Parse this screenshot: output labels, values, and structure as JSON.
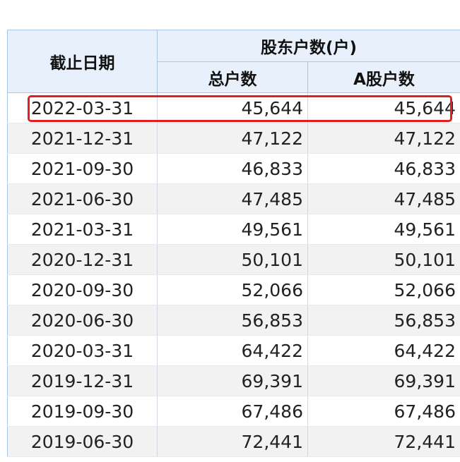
{
  "table": {
    "headers": {
      "date": "截止日期",
      "group": "股东户数(户)",
      "total": "总户数",
      "a_share": "A股户数"
    },
    "rows": [
      {
        "date": "2022-03-31",
        "total": "45,644",
        "a_share": "45,644"
      },
      {
        "date": "2021-12-31",
        "total": "47,122",
        "a_share": "47,122"
      },
      {
        "date": "2021-09-30",
        "total": "46,833",
        "a_share": "46,833"
      },
      {
        "date": "2021-06-30",
        "total": "47,485",
        "a_share": "47,485"
      },
      {
        "date": "2021-03-31",
        "total": "49,561",
        "a_share": "49,561"
      },
      {
        "date": "2020-12-31",
        "total": "50,101",
        "a_share": "50,101"
      },
      {
        "date": "2020-09-30",
        "total": "52,066",
        "a_share": "52,066"
      },
      {
        "date": "2020-06-30",
        "total": "56,853",
        "a_share": "56,853"
      },
      {
        "date": "2020-03-31",
        "total": "64,422",
        "a_share": "64,422"
      },
      {
        "date": "2019-12-31",
        "total": "69,391",
        "a_share": "69,391"
      },
      {
        "date": "2019-09-30",
        "total": "67,486",
        "a_share": "67,486"
      },
      {
        "date": "2019-06-30",
        "total": "72,441",
        "a_share": "72,441"
      }
    ]
  },
  "highlight": {
    "row_index": 0,
    "color": "#e02020"
  }
}
